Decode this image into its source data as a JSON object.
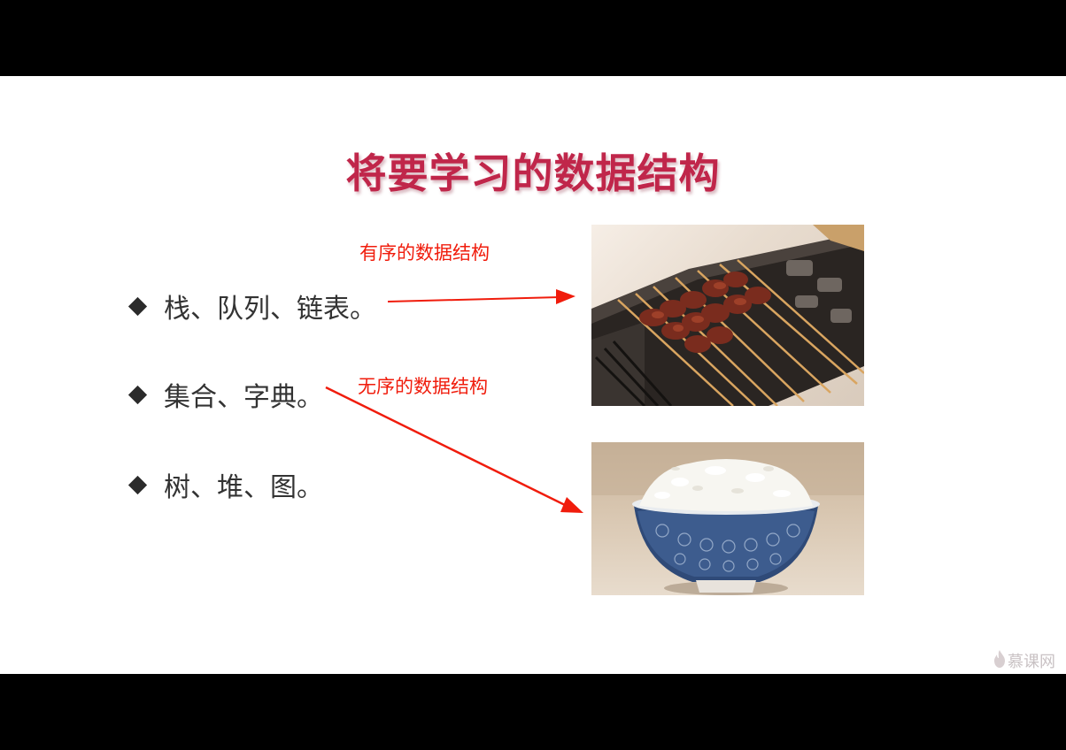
{
  "slide": {
    "title": "将要学习的数据结构",
    "bullets": [
      "栈、队列、链表。",
      "集合、字典。",
      "树、堆、图。"
    ],
    "annotations": {
      "ordered": "有序的数据结构",
      "unordered": "无序的数据结构"
    },
    "images": {
      "top": "grilled-skewers-photo",
      "bottom": "rice-bowl-photo"
    },
    "accent_color": "#c0264a",
    "annotation_color": "#f01c0c",
    "watermark": "慕课网"
  }
}
